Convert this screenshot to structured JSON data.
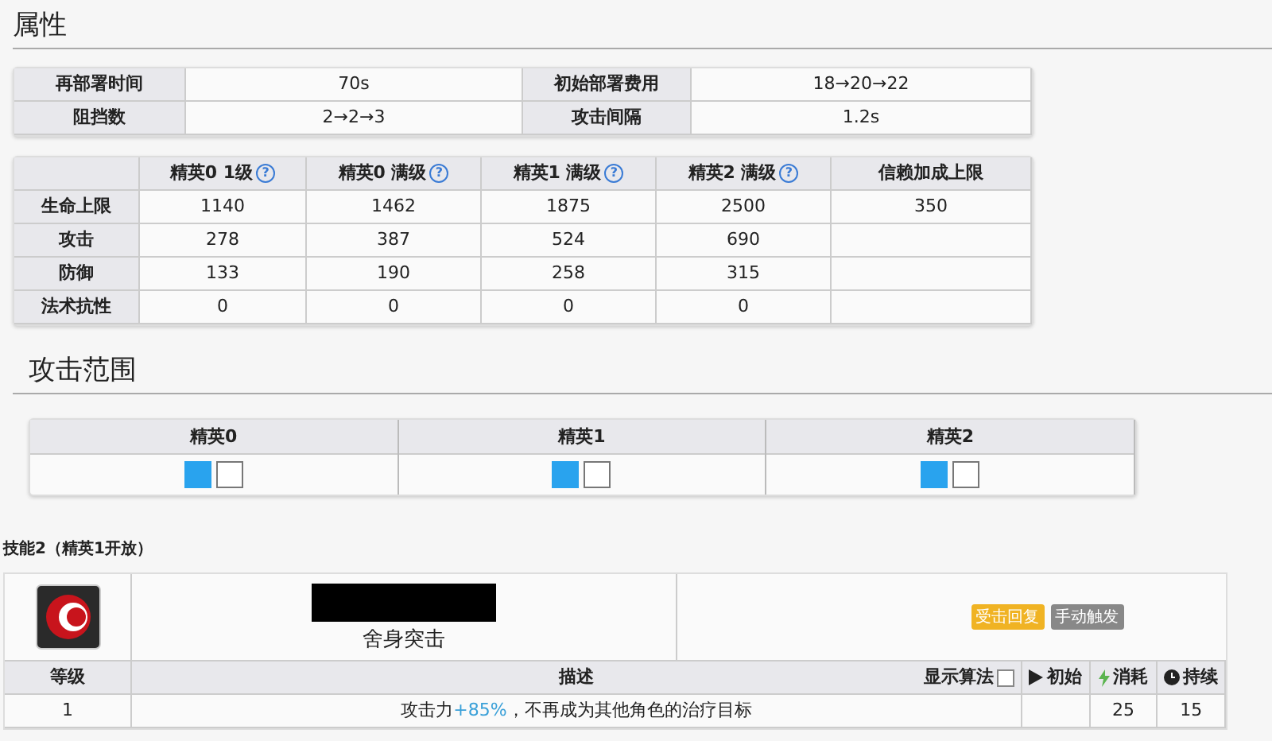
{
  "attributes": {
    "title": "属性",
    "basic": [
      {
        "label": "再部署时间",
        "value": "70s",
        "label2": "初始部署费用",
        "value2": "18→20→22"
      },
      {
        "label": "阻挡数",
        "value": "2→2→3",
        "label2": "攻击间隔",
        "value2": "1.2s"
      }
    ],
    "stats_columns": [
      {
        "label": "精英0 1级",
        "help": "?"
      },
      {
        "label": "精英0 满级",
        "help": "?"
      },
      {
        "label": "精英1 满级",
        "help": "?"
      },
      {
        "label": "精英2 满级",
        "help": "?"
      },
      {
        "label": "信赖加成上限"
      }
    ],
    "stats_rows": [
      {
        "label": "生命上限",
        "cells": [
          "1140",
          "1462",
          "1875",
          "2500",
          "350"
        ]
      },
      {
        "label": "攻击",
        "cells": [
          "278",
          "387",
          "524",
          "690"
        ]
      },
      {
        "label": "防御",
        "cells": [
          "133",
          "190",
          "258",
          "315"
        ]
      },
      {
        "label": "法术抗性",
        "cells": [
          "0",
          "0",
          "0",
          "0"
        ]
      }
    ]
  },
  "range": {
    "title": "攻击范围",
    "columns": [
      {
        "label": "精英0",
        "cells": [
          {
            "selected": true
          },
          {
            "selected": false
          }
        ]
      },
      {
        "label": "精英1",
        "cells": [
          {
            "selected": true
          },
          {
            "selected": false
          }
        ]
      },
      {
        "label": "精英2",
        "cells": [
          {
            "selected": true
          },
          {
            "selected": false
          }
        ]
      }
    ]
  },
  "skill": {
    "label": "技能2（精英1开放）",
    "name": "舍身突击",
    "tags": [
      {
        "label": "受击回复",
        "color": "#f0b323"
      },
      {
        "label": "手动触发",
        "color": "#888888"
      }
    ],
    "columns": {
      "level": "等级",
      "description": "描述",
      "formula_toggle": "显示算法",
      "formula_checked": false,
      "initial": "初始",
      "cost": "消耗",
      "duration": "持续"
    },
    "rows": [
      {
        "level": "1",
        "description": "攻击力**+85%**，不再成为其他角色的治疗目标",
        "cost": "25",
        "duration": "15"
      }
    ]
  }
}
